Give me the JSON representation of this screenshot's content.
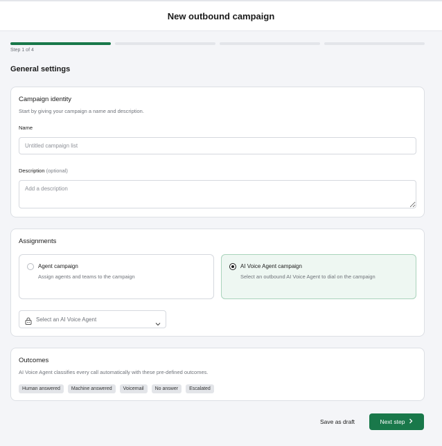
{
  "header": {
    "title": "New outbound campaign"
  },
  "progress": {
    "current_step": 1,
    "total_steps": 4,
    "step_text": "Step 1 of 4",
    "accent": "#19784a"
  },
  "page": {
    "section_title": "General settings"
  },
  "identity": {
    "title": "Campaign identity",
    "subtitle": "Start by giving your campaign a name and description.",
    "name_label": "Name",
    "name_placeholder": "Untitled campaign list",
    "name_value": "",
    "description_label": "Description",
    "description_optional": "(optional)",
    "description_placeholder": "Add a description",
    "description_value": ""
  },
  "assignments": {
    "title": "Assignments",
    "options": [
      {
        "title": "Agent campaign",
        "description": "Assign agents and teams to the campaign",
        "selected": false
      },
      {
        "title": "AI Voice Agent campaign",
        "description": "Select an outbound AI Voice Agent to dial on the campaign",
        "selected": true
      }
    ],
    "agent_select": {
      "placeholder": "Select an AI Voice Agent",
      "icon": "robot-lock-icon"
    }
  },
  "outcomes": {
    "title": "Outcomes",
    "subtitle": "AI Voice Agent classifies every call automatically with these pre-defined outcomes.",
    "chips": [
      "Human answered",
      "Machine answered",
      "Voicemail",
      "No answer",
      "Escalated"
    ]
  },
  "footer": {
    "save_draft_label": "Save as draft",
    "next_label": "Next step"
  }
}
